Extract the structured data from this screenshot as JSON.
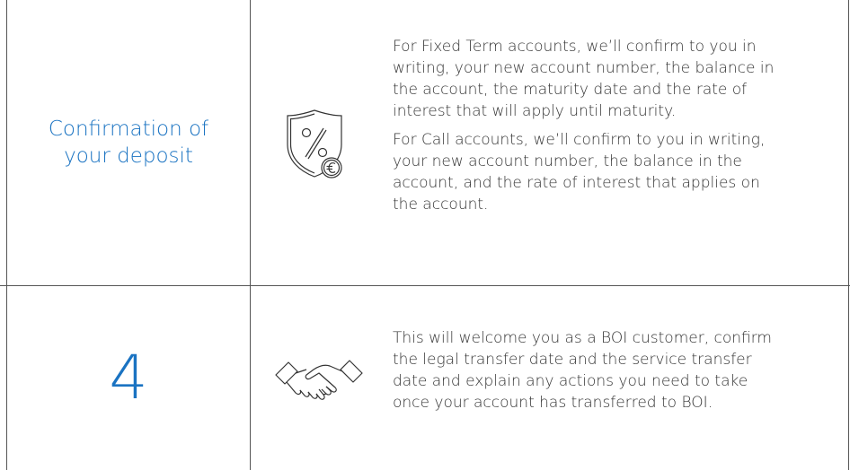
{
  "rows": [
    {
      "heading": "Confirmation of your deposit",
      "icon": "shield-percent-euro-icon",
      "paragraphs": [
        "For Fixed Term accounts, we’ll confirm to you in writing, your new account number, the balance in the account, the maturity date and the rate of interest that will apply until maturity.",
        "For Call accounts, we’ll confirm to you in writing, your new account number, the balance in the account, and the rate of interest that applies on the account."
      ]
    },
    {
      "heading": "4",
      "icon": "handshake-icon",
      "paragraphs": [
        "This will welcome you as a BOI customer, confirm the legal transfer date and the service transfer date and explain any actions you need to take once your account has transferred to BOI."
      ]
    }
  ],
  "colors": {
    "accent": "#1a73c2",
    "text": "#333333",
    "rule": "#555555"
  }
}
